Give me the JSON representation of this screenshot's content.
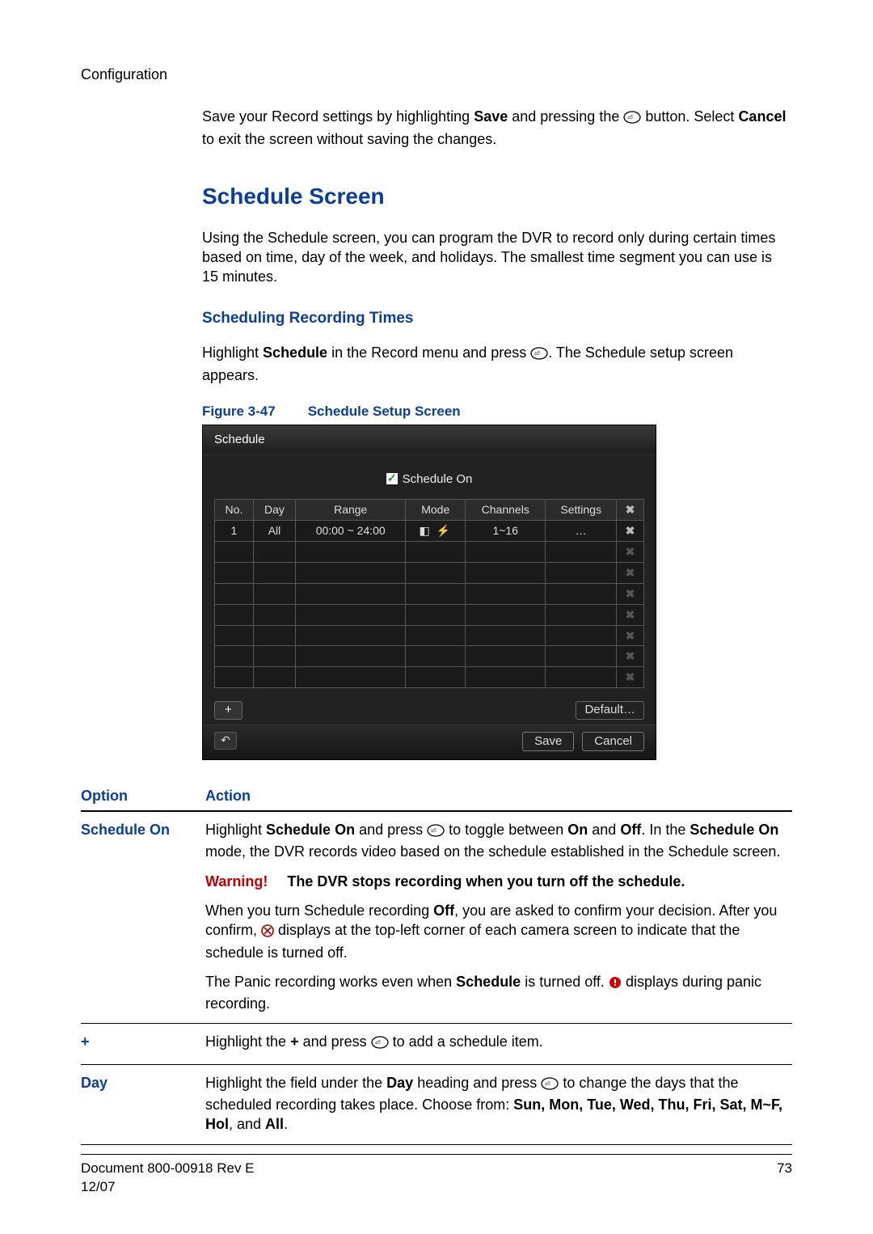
{
  "header": {
    "section": "Configuration"
  },
  "intro": {
    "p1a": "Save your Record settings by highlighting ",
    "save_word": "Save",
    "p1b": " and pressing the ",
    "p1c": " button. Select ",
    "cancel_word": "Cancel",
    "p1d": " to exit the screen without saving the changes."
  },
  "heading": "Schedule Screen",
  "sched_para": "Using the Schedule screen, you can program the DVR to record only during certain times based on time, day of the week, and holidays. The smallest time segment you can use is 15 minutes.",
  "subheading": "Scheduling Recording Times",
  "sched_intro": {
    "a": "Highlight ",
    "schedule_word": "Schedule",
    "b": " in the Record menu and press ",
    "c": ". The Schedule setup screen appears."
  },
  "figure": {
    "num": "Figure 3-47",
    "title": "Schedule Setup Screen"
  },
  "shot": {
    "title": "Schedule",
    "schedule_on_label": "Schedule On",
    "headers": [
      "No.",
      "Day",
      "Range",
      "Mode",
      "Channels",
      "Settings",
      "✖"
    ],
    "row1": {
      "no": "1",
      "day": "All",
      "range": "00:00 ~ 24:00",
      "mode": "◧ ⚡",
      "channels": "1~16",
      "settings": "…",
      "x": "✖"
    },
    "blank_rows": 7,
    "plus": "+",
    "default": "Default…",
    "save": "Save",
    "cancel": "Cancel",
    "back": "↶"
  },
  "opts": {
    "col_option": "Option",
    "col_action": "Action",
    "rows": [
      {
        "name": "Schedule On",
        "p1": {
          "a": "Highlight ",
          "b": "Schedule On",
          "c": " and press ",
          "d": " to toggle between ",
          "on": "On",
          "e": " and ",
          "off": "Off",
          "f": ". In the ",
          "g": "Schedule On",
          "h": " mode, the DVR records video based on the schedule established in the Schedule screen."
        },
        "warn_label": "Warning!",
        "warn_text": "The DVR stops recording when you turn off the schedule.",
        "p2": {
          "a": "When you turn Schedule recording ",
          "off": "Off",
          "b": ", you are asked to confirm your decision. After you confirm, ",
          "c": " displays at the top-left corner of each camera screen to indicate that the schedule is turned off."
        },
        "p3": {
          "a": "The Panic recording works even when ",
          "sched": "Schedule",
          "b": " is turned off. ",
          "c": " displays during panic recording."
        }
      },
      {
        "name": "+",
        "p1": {
          "a": "Highlight the ",
          "plus": "+",
          "b": " and press ",
          "c": " to add a schedule item."
        }
      },
      {
        "name": "Day",
        "p1": {
          "a": "Highlight the field under the ",
          "day": "Day",
          "b": " heading and press ",
          "c": " to change the days that the scheduled recording takes place. Choose from: ",
          "list": "Sun, Mon, Tue, Wed, Thu, Fri, Sat, M~F, Hol",
          "d": ", and ",
          "all": "All",
          "e": "."
        }
      }
    ]
  },
  "footer": {
    "doc": "Document 800-00918 Rev E",
    "date": "12/07",
    "page": "73"
  }
}
